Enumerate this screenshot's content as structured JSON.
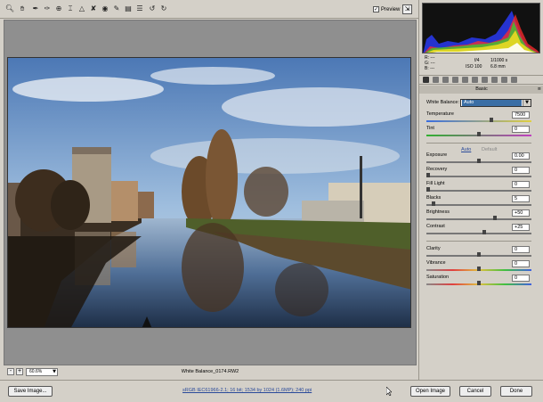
{
  "toolbar": {
    "tools": [
      "zoom-tool-icon",
      "hand-tool-icon",
      "white-balance-tool-icon",
      "color-sampler-icon",
      "target-adjust-icon",
      "crop-tool-icon",
      "straighten-tool-icon",
      "spot-removal-icon",
      "red-eye-icon",
      "adjustment-brush-icon",
      "graduated-filter-icon",
      "preferences-icon",
      "rotate-ccw-icon",
      "rotate-cw-icon"
    ],
    "preview_label": "Preview",
    "preview_checked": true
  },
  "status": {
    "zoom": "60.6%",
    "filename": "White Balance_0174.RW2"
  },
  "readout": {
    "r": "R:  ---",
    "g": "G:  ---",
    "b": "B:  ---",
    "aperture": "f/4",
    "shutter": "1/1000 s",
    "iso": "ISO 100",
    "focal": "6.8 mm"
  },
  "panel": {
    "section_title": "Basic",
    "white_balance_label": "White Balance:",
    "white_balance_value": "Auto",
    "auto_label": "Auto",
    "default_label": "Default",
    "sliders": [
      {
        "id": "temperature",
        "label": "Temperature",
        "value": "7500",
        "pos": 0.62
      },
      {
        "id": "tint",
        "label": "Tint",
        "value": "0",
        "pos": 0.5
      },
      {
        "id": "exposure",
        "label": "Exposure",
        "value": "0.00",
        "pos": 0.5
      },
      {
        "id": "recovery",
        "label": "Recovery",
        "value": "0",
        "pos": 0.0
      },
      {
        "id": "fill-light",
        "label": "Fill Light",
        "value": "0",
        "pos": 0.0
      },
      {
        "id": "blacks",
        "label": "Blacks",
        "value": "5",
        "pos": 0.05
      },
      {
        "id": "brightness",
        "label": "Brightness",
        "value": "+50",
        "pos": 0.66
      },
      {
        "id": "contrast",
        "label": "Contrast",
        "value": "+25",
        "pos": 0.55
      },
      {
        "id": "clarity",
        "label": "Clarity",
        "value": "0",
        "pos": 0.5
      },
      {
        "id": "vibrance",
        "label": "Vibrance",
        "value": "0",
        "pos": 0.5
      },
      {
        "id": "saturation",
        "label": "Saturation",
        "value": "0",
        "pos": 0.5
      }
    ]
  },
  "footer": {
    "save_label": "Save Image...",
    "workflow_text": "sRGB IEC61966-2.1; 16 bit; 1534 by 1024 (1.6MP); 240 ppi",
    "open_label": "Open Image",
    "cancel_label": "Cancel",
    "done_label": "Done"
  },
  "colors": {
    "accent": "#3a6ea5",
    "panel_bg": "#d4d0c8",
    "canvas_bg": "#8f8f8f"
  }
}
